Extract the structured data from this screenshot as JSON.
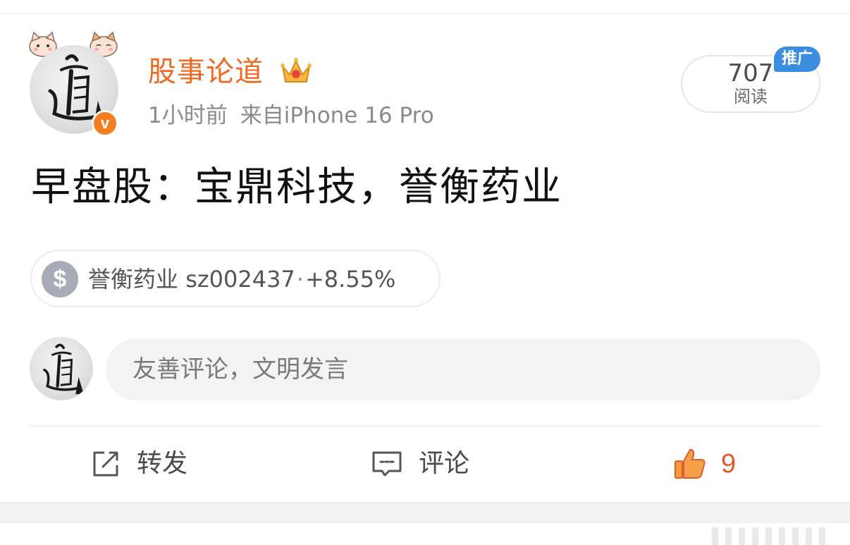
{
  "post": {
    "username": "股事论道",
    "time": "1小时前",
    "source": "来自iPhone 16 Pro",
    "read_count": "707",
    "read_label": "阅读",
    "promo_badge": "推广",
    "text": "早盘股：宝鼎科技，誉衡药业"
  },
  "stock": {
    "icon": "dollar-icon",
    "name": "誉衡药业",
    "code": "sz002437",
    "separator": "·",
    "change": "+8.55%"
  },
  "comment": {
    "placeholder": "友善评论，文明发言"
  },
  "actions": {
    "repost_label": "转发",
    "comment_label": "评论",
    "like_count": "9"
  },
  "colors": {
    "username": "#f0691f",
    "verified": "#f57c1f",
    "promo": "#3b8de0",
    "like": "#e05a2b"
  }
}
